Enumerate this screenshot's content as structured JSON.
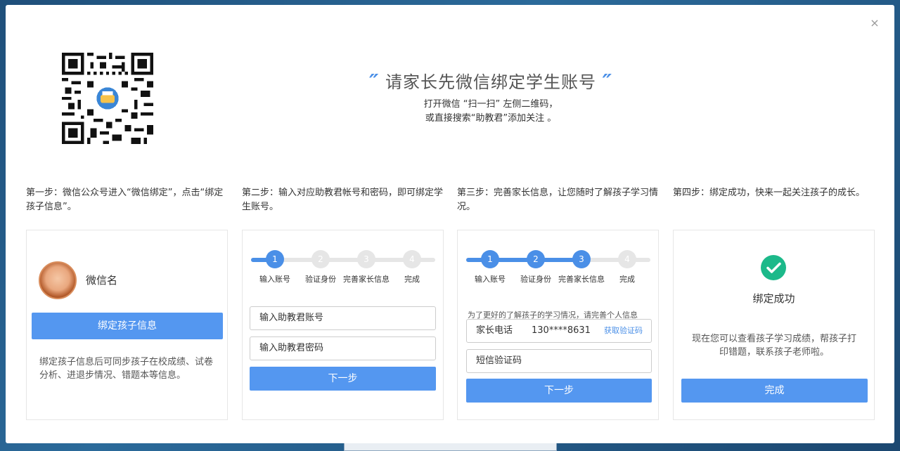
{
  "dialog": {
    "close_label": "×"
  },
  "hero": {
    "title": "请家长先微信绑定学生账号",
    "subtitle_line1": "打开微信 “扫一扫” 左侧二维码，",
    "subtitle_line2": "或直接搜索“助教君”添加关注 。"
  },
  "steps": [
    {
      "desc": "第一步：微信公众号进入“微信绑定”，点击“绑定孩子信息”。"
    },
    {
      "desc": "第二步：输入对应助教君帐号和密码，即可绑定学生账号。"
    },
    {
      "desc": "第三步：完善家长信息，让您随时了解孩子学习情况。"
    },
    {
      "desc": "第四步：绑定成功，快来一起关注孩子的成长。"
    }
  ],
  "progress_labels": [
    "输入账号",
    "验证身份",
    "完善家长信息",
    "完成"
  ],
  "progress_numbers": [
    "1",
    "2",
    "3",
    "4"
  ],
  "card1": {
    "wechat_name": "微信名",
    "bind_button": "绑定孩子信息",
    "note": "绑定孩子信息后可同步孩子在校成绩、试卷分析、进退步情况、错题本等信息。"
  },
  "card2": {
    "current_step": 1,
    "account_placeholder": "输入助教君账号",
    "password_placeholder": "输入助教君密码",
    "next_button": "下一步"
  },
  "card3": {
    "current_step": 3,
    "hint": "为了更好的了解孩子的学习情况，请完善个人信息",
    "phone_label": "家长电话",
    "phone_value": "130****8631",
    "get_code": "获取验证码",
    "sms_placeholder": "短信验证码",
    "next_button": "下一步"
  },
  "card4": {
    "success_title": "绑定成功",
    "note": "现在您可以查看孩子学习成绩，帮孩子打印错题，联系孩子老师啦。",
    "done_button": "完成"
  },
  "colors": {
    "accent": "#4a8fe7",
    "button": "#5497f0",
    "success": "#1cb98a"
  }
}
